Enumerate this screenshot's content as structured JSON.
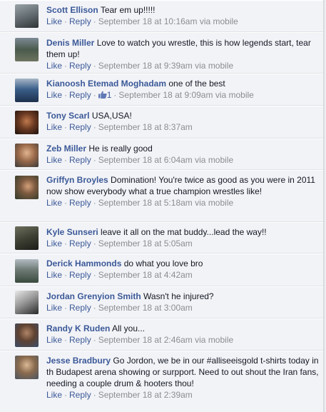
{
  "actions": {
    "like": "Like",
    "reply": "Reply",
    "separator": "·"
  },
  "comments": [
    {
      "author": "Scott Ellison",
      "text": "Tear em up!!!!!",
      "time": "September 18 at 10:16am",
      "via": "via mobile",
      "likes": ""
    },
    {
      "author": "Denis Miller",
      "text": "Love to watch you wrestle, this is how legends start, tear them up!",
      "time": "September 18 at 9:39am",
      "via": "via mobile",
      "likes": ""
    },
    {
      "author": "Kianoosh Etemad Moghadam",
      "text": "one of the best",
      "time": "September 18 at 9:09am",
      "via": "via mobile",
      "likes": "1"
    },
    {
      "author": "Tony Scarl",
      "text": "USA,USA!",
      "time": "September 18 at 8:37am",
      "via": "",
      "likes": ""
    },
    {
      "author": "Zeb Miller",
      "text": "He is really good",
      "time": "September 18 at 6:04am",
      "via": "via mobile",
      "likes": ""
    },
    {
      "author": "Griffyn Broyles",
      "text": "Domination! You're twice as good as you were in 2011 now show everybody what a true champion wrestles like!",
      "time": "September 18 at 5:18am",
      "via": "via mobile",
      "likes": ""
    },
    {
      "author": "Kyle Sunseri",
      "text": "leave it all on the mat buddy...lead the way!!",
      "time": "September 18 at 5:05am",
      "via": "",
      "likes": ""
    },
    {
      "author": "Derick Hammonds",
      "text": "do what you love bro",
      "time": "September 18 at 4:42am",
      "via": "",
      "likes": ""
    },
    {
      "author": "Jordan Grenyion Smith",
      "text": "Wasn't he injured?",
      "time": "September 18 at 3:00am",
      "via": "",
      "likes": ""
    },
    {
      "author": "Randy K Ruden",
      "text": "All you...",
      "time": "September 18 at 2:46am",
      "via": "via mobile",
      "likes": ""
    },
    {
      "author": "Jesse Bradbury",
      "text": "Go Jordon, we be in our #alliseeisgold t-shirts today in th Budapest arena showing or surpport. Need to out shout the Iran fans, needing a couple drum & hooters thou!",
      "time": "September 18 at 2:39am",
      "via": "",
      "likes": ""
    }
  ],
  "colors": {
    "link": "#3b5998",
    "meta": "#8a8d91",
    "background": "#f2f3f7"
  }
}
